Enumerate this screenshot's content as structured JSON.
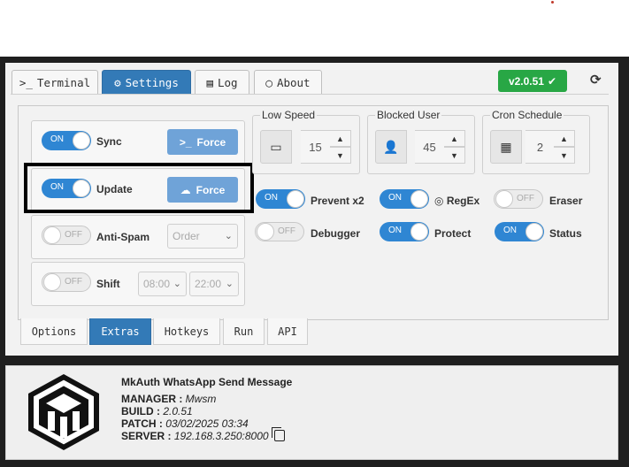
{
  "tabs": [
    {
      "label": "Terminal",
      "icon": "terminal-icon"
    },
    {
      "label": "Settings",
      "icon": "cogs-icon"
    },
    {
      "label": "Log",
      "icon": "list-icon"
    },
    {
      "label": "About",
      "icon": "comment-icon"
    }
  ],
  "version": {
    "label": "v2.0.51",
    "icon": "check-icon",
    "color": "#28a745"
  },
  "left_rows": [
    {
      "label": "Sync",
      "toggle": "ON",
      "state": "on",
      "button": "Force",
      "button_icon": "terminal-icon"
    },
    {
      "label": "Update",
      "toggle": "ON",
      "state": "on",
      "button": "Force",
      "button_icon": "cloud-download-icon"
    },
    {
      "label": "Anti-Spam",
      "toggle": "OFF",
      "state": "off",
      "select": "Order"
    },
    {
      "label": "Shift",
      "toggle": "OFF",
      "state": "off",
      "select_start": "08:00",
      "select_end": "22:00"
    }
  ],
  "fieldsets": [
    {
      "legend": "Low Speed",
      "icon": "battery-icon",
      "value": "15"
    },
    {
      "legend": "Blocked User",
      "icon": "user-times-icon",
      "value": "45"
    },
    {
      "legend": "Cron Schedule",
      "icon": "calendar-icon",
      "value": "2"
    }
  ],
  "toggles": [
    {
      "label": "Prevent x2",
      "toggle": "ON",
      "state": "on"
    },
    {
      "label": "RegEx",
      "toggle": "ON",
      "state": "on",
      "icon": "whatsapp-icon"
    },
    {
      "label": "Eraser",
      "toggle": "OFF",
      "state": "off"
    },
    {
      "label": "Debugger",
      "toggle": "OFF",
      "state": "off"
    },
    {
      "label": "Protect",
      "toggle": "ON",
      "state": "on"
    },
    {
      "label": "Status",
      "toggle": "ON",
      "state": "on"
    }
  ],
  "bottom_tabs": [
    "Options",
    "Extras",
    "Hotkeys",
    "Run",
    "API"
  ],
  "active_bottom_tab": "Extras",
  "info": {
    "title": "MkAuth WhatsApp Send Message",
    "manager_label": "MANAGER :",
    "manager_value": "Mwsm",
    "build_label": "BUILD :",
    "build_value": "2.0.51",
    "patch_label": "PATCH :",
    "patch_value": "03/02/2025 03:34",
    "server_label": "SERVER :",
    "server_value": "192.168.3.250:8000"
  },
  "colors": {
    "accent": "#337ab7",
    "toggle_on": "#2f86d3",
    "force_button": "#6fa3d8"
  }
}
